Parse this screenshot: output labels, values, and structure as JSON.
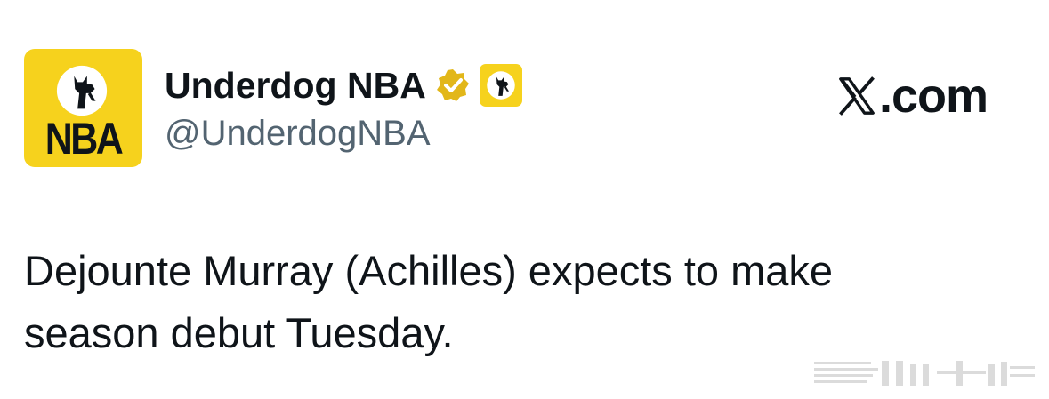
{
  "account": {
    "avatar_text": "NBA",
    "display_name": "Underdog NBA",
    "handle": "@UnderdogNBA",
    "verified_badge_icon": "gold-verified-badge-icon",
    "affiliate_badge_icon": "underdog-dog-logo-icon"
  },
  "source": {
    "icon": "x-logo-icon",
    "label": ".com"
  },
  "tweet": {
    "text": "Dejounte Murray (Achilles) expects to make\nseason debut Tuesday."
  },
  "colors": {
    "brand_yellow": "#f6d21d",
    "verified_gold": "#e2b719",
    "text_primary": "#0f1419",
    "text_secondary": "#536471",
    "background": "#ffffff"
  }
}
